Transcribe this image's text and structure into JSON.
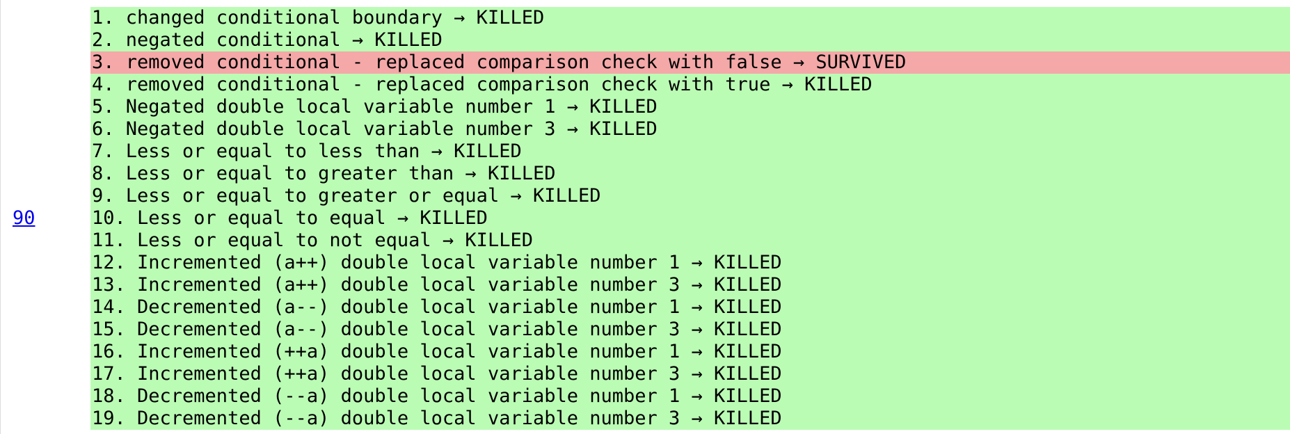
{
  "line_number": "90",
  "colors": {
    "killed_background": "#bbfcb5",
    "survived_background": "#f4a8a8",
    "link": "#0000ee"
  },
  "mutations": [
    {
      "text": "1. changed conditional boundary → KILLED",
      "status": "KILLED"
    },
    {
      "text": "2. negated conditional → KILLED",
      "status": "KILLED"
    },
    {
      "text": "3. removed conditional - replaced comparison check with false → SURVIVED",
      "status": "SURVIVED"
    },
    {
      "text": "4. removed conditional - replaced comparison check with true → KILLED",
      "status": "KILLED"
    },
    {
      "text": "5. Negated double local variable number 1 → KILLED",
      "status": "KILLED"
    },
    {
      "text": "6. Negated double local variable number 3 → KILLED",
      "status": "KILLED"
    },
    {
      "text": "7. Less or equal to less than → KILLED",
      "status": "KILLED"
    },
    {
      "text": "8. Less or equal to greater than → KILLED",
      "status": "KILLED"
    },
    {
      "text": "9. Less or equal to greater or equal → KILLED",
      "status": "KILLED"
    },
    {
      "text": "10. Less or equal to equal → KILLED",
      "status": "KILLED"
    },
    {
      "text": "11. Less or equal to not equal → KILLED",
      "status": "KILLED"
    },
    {
      "text": "12. Incremented (a++) double local variable number 1 → KILLED",
      "status": "KILLED"
    },
    {
      "text": "13. Incremented (a++) double local variable number 3 → KILLED",
      "status": "KILLED"
    },
    {
      "text": "14. Decremented (a--) double local variable number 1 → KILLED",
      "status": "KILLED"
    },
    {
      "text": "15. Decremented (a--) double local variable number 3 → KILLED",
      "status": "KILLED"
    },
    {
      "text": "16. Incremented (++a) double local variable number 1 → KILLED",
      "status": "KILLED"
    },
    {
      "text": "17. Incremented (++a) double local variable number 3 → KILLED",
      "status": "KILLED"
    },
    {
      "text": "18. Decremented (--a) double local variable number 1 → KILLED",
      "status": "KILLED"
    },
    {
      "text": "19. Decremented (--a) double local variable number 3 → KILLED",
      "status": "KILLED"
    }
  ]
}
